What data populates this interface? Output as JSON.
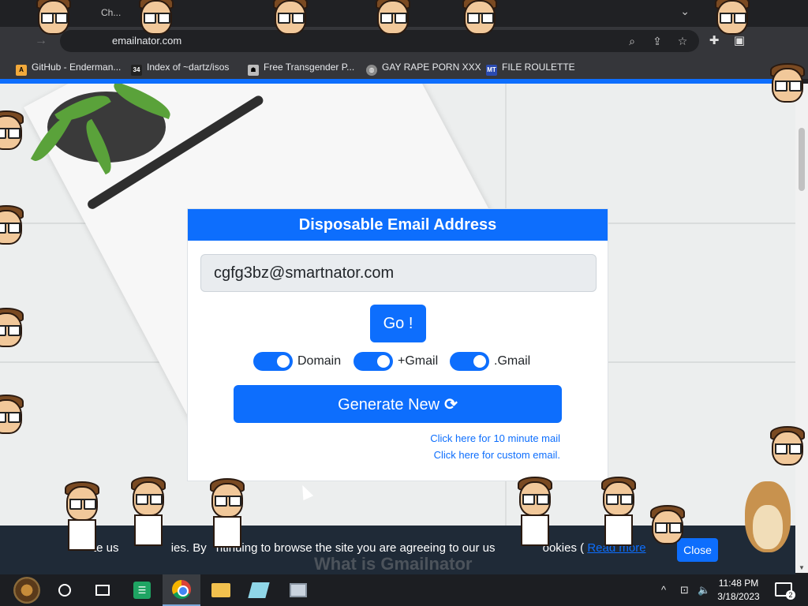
{
  "browser": {
    "tab_title": "Ch...",
    "url": "emailnator.com",
    "bookmarks": [
      {
        "label": "GitHub - Enderman...",
        "icon": "github-icon"
      },
      {
        "label": "Index of ~dartz/isos",
        "icon": "dartz-icon"
      },
      {
        "label": "Free Transgender P...",
        "icon": "site-icon"
      },
      {
        "label": "GAY RAPE PORN XXX",
        "icon": "globe-icon"
      },
      {
        "label": "FILE ROULETTE",
        "icon": "roulette-icon"
      }
    ]
  },
  "card": {
    "header": "Disposable Email Address",
    "email": "cgfg3bz@smartnator.com",
    "go_label": "Go !",
    "toggles": [
      {
        "label": "Domain",
        "on": true
      },
      {
        "label": "+Gmail",
        "on": true
      },
      {
        "label": ".Gmail",
        "on": true
      }
    ],
    "generate_label": "Generate New",
    "links": [
      "Click here for 10 minute mail",
      "Click here for custom email."
    ]
  },
  "cookie": {
    "text_a": "te us",
    "text_b": "ies. By",
    "text_c": "ntinuing to browse the site you are agreeing to our us",
    "text_d": "ookies (",
    "link": "Read more",
    "close_label": "Close",
    "under_heading": "What is Gmailnator"
  },
  "taskbar": {
    "time": "11:48 PM",
    "date": "3/18/2023",
    "notification_count": "2"
  }
}
